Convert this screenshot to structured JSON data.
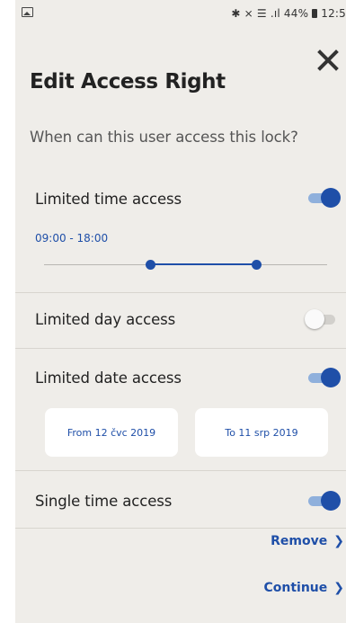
{
  "status_bar": {
    "right_text": "✱ ⨯ ☰ .ıl 44%",
    "time": "12:5"
  },
  "header": {
    "title": "Edit Access Right",
    "subtitle": "When can this user access this lock?"
  },
  "time_access": {
    "label": "Limited time access",
    "enabled": true,
    "range_text": "09:00 - 18:00",
    "slider_start_fraction": 0.375,
    "slider_end_fraction": 0.75
  },
  "day_access": {
    "label": "Limited day access",
    "enabled": false
  },
  "date_access": {
    "label": "Limited date access",
    "enabled": true,
    "from_label": "From 12 čvc 2019",
    "to_label": "To 11 srp 2019"
  },
  "single_access": {
    "label": "Single time access",
    "enabled": true
  },
  "actions": {
    "remove_label": "Remove",
    "continue_label": "Continue"
  },
  "colors": {
    "accent": "#1f4fa8",
    "background": "#efede9"
  },
  "icons": {
    "close": "close-icon",
    "chevron": "chevron-right-icon"
  }
}
